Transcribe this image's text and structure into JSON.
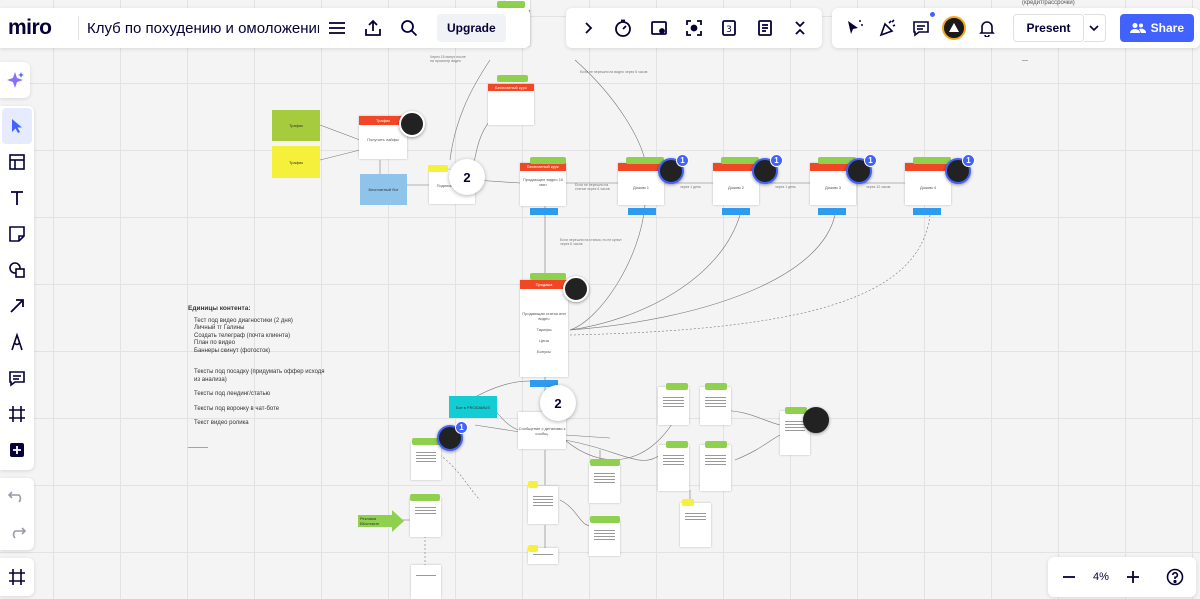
{
  "app": {
    "logo": "miro",
    "board_title": "Клуб по похудению и омоложению",
    "upgrade_label": "Upgrade",
    "present_label": "Present",
    "share_label": "Share"
  },
  "toolbar_top": {
    "left_icons": [
      "menu-icon",
      "export-icon",
      "search-icon"
    ],
    "mid_icons": [
      "chevron-right-icon",
      "timer-icon",
      "card-icon",
      "focus-icon",
      "vote-icon",
      "notes-icon",
      "collapse-icon"
    ],
    "right_icons": [
      "reaction-icon",
      "celebrate-icon",
      "comment-icon",
      "avatar",
      "bell-icon"
    ]
  },
  "toolbar_left": {
    "tools": [
      "ai-sparkle-icon",
      "select-icon",
      "templates-icon",
      "text-icon",
      "sticky-note-icon",
      "shapes-icon",
      "arrow-icon",
      "pen-icon",
      "comment-icon",
      "frame-icon",
      "add-icon"
    ],
    "undo": "undo-icon",
    "redo": "redo-icon",
    "frames": "frames-list-icon"
  },
  "zoom": {
    "value": "4%"
  },
  "colors": {
    "accent": "#4262ff",
    "card_header": "#f24726",
    "card_tag": "#8fd14f",
    "card_footer": "#2d9bf0",
    "sticky_lime": "#a6cc3d",
    "sticky_yellow": "#f5f03a",
    "sticky_blue": "#8fc4ea",
    "sticky_cyan": "#12cdd4"
  },
  "board": {
    "top_right_note": "(кредит/рассрочки)",
    "badges": [
      "2",
      "2"
    ],
    "notifications": [
      "1",
      "1",
      "1",
      "1",
      "1"
    ],
    "stickies": {
      "lime": "Трафик",
      "yellow": "Трафик",
      "blue": "Бесплатный бот",
      "cyan": "Бот в PRODAMUS",
      "arrow": "Реклама ВКонтакте"
    },
    "cards": {
      "top": "Бесплатный курс",
      "traffic": "Трафик",
      "traffic_body": "Получить лайфы",
      "sub": "Подписка на бот",
      "free_video": "Бесплатный курс",
      "free_video_body": "Продающее видео 10 мин",
      "d1": "Дожим 1",
      "d2": "Дожим 2",
      "d3": "Дожим 3",
      "d4": "Дожим 4",
      "sale": "Продажа",
      "sale_body": "Продающая статья или видео",
      "tariff": "Тарифы",
      "price": "Цена",
      "bonus": "Бонусы",
      "msg": "Сообщение с деталями к сообщ."
    },
    "content_block": {
      "heading": "Единицы контента:",
      "items_1": [
        "Тест под видео диагностики (2 дня)",
        "Личный тг Галины",
        "Создать телеграф (почта клиента)",
        "План по видео",
        "Баннеры скинут (фотосток)"
      ],
      "items_2": [
        "Тексты под посадку (придумать оффер исходя из анализа)"
      ],
      "items_3": [
        "Тексты под лендинг/статью"
      ],
      "items_4": [
        "Тексты под воронку в чат-боте"
      ],
      "items_5": [
        "Текст видео ролика"
      ],
      "footer": "______"
    },
    "conn_labels": [
      "Через 15 минут после на просмотр видео",
      "Если не перешли на видео через 6 часов",
      "Если не перешли на статью через 6 часов",
      "через 1 день",
      "через 1 день",
      "через 12 часов",
      "Если перешли на статью, но не купил через 6 часов"
    ]
  }
}
